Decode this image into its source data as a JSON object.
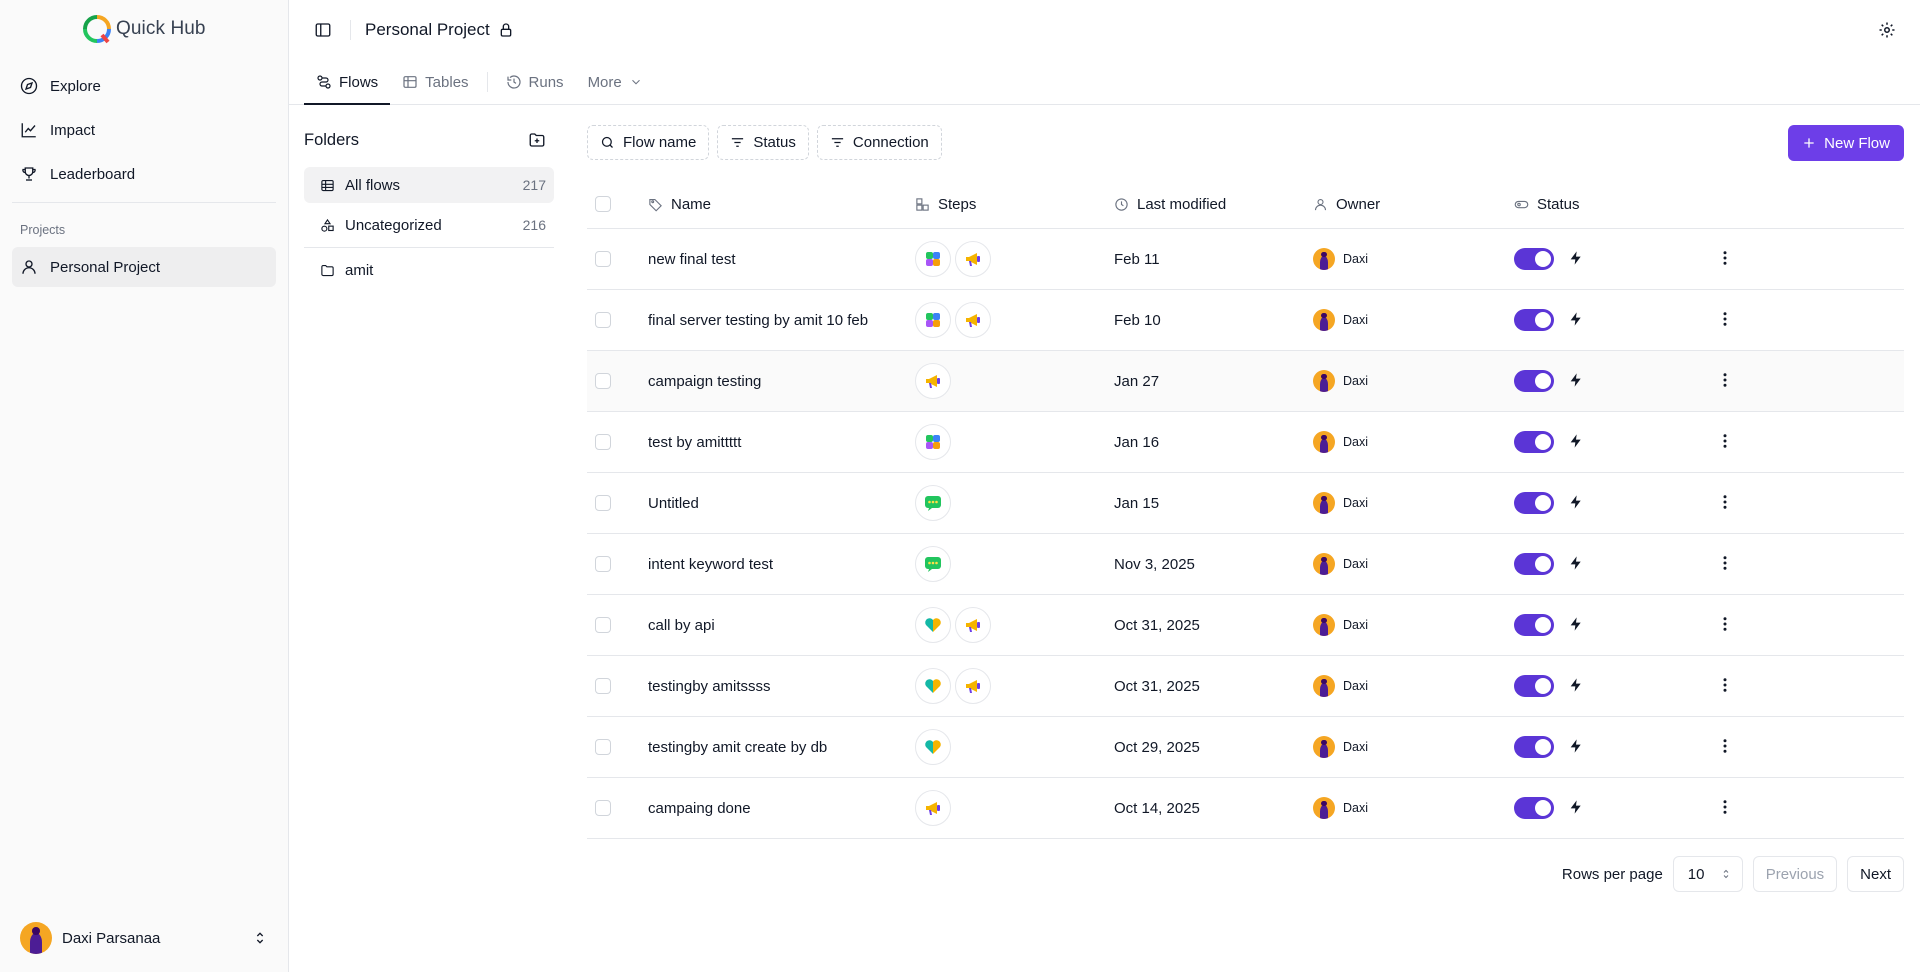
{
  "brand": {
    "name": "Quick Hub"
  },
  "sidebar": {
    "nav": [
      {
        "label": "Explore",
        "icon": "compass-icon"
      },
      {
        "label": "Impact",
        "icon": "chart-line-icon"
      },
      {
        "label": "Leaderboard",
        "icon": "trophy-icon"
      }
    ],
    "projects_label": "Projects",
    "project": {
      "label": "Personal Project",
      "icon": "user-icon"
    },
    "user": {
      "name": "Daxi Parsanaa"
    }
  },
  "header": {
    "title": "Personal Project"
  },
  "tabs": [
    {
      "label": "Flows",
      "active": true
    },
    {
      "label": "Tables",
      "active": false
    },
    {
      "label": "Runs",
      "active": false
    },
    {
      "label": "More",
      "active": false
    }
  ],
  "folders": {
    "title": "Folders",
    "items": [
      {
        "label": "All flows",
        "count": "217"
      },
      {
        "label": "Uncategorized",
        "count": "216"
      },
      {
        "label": "amit",
        "count": ""
      }
    ]
  },
  "filters": {
    "flow_name": "Flow name",
    "status": "Status",
    "connection": "Connection"
  },
  "new_flow_label": "New Flow",
  "table": {
    "columns": {
      "name": "Name",
      "steps": "Steps",
      "modified": "Last modified",
      "owner": "Owner",
      "status": "Status"
    },
    "rows": [
      {
        "name": "new final test",
        "steps": [
          "multicolor-app-icon",
          "megaphone-icon"
        ],
        "modified": "Feb 11",
        "owner": "Daxi",
        "enabled": true
      },
      {
        "name": "final server testing by amit 10 feb",
        "steps": [
          "multicolor-app-icon",
          "megaphone-icon"
        ],
        "modified": "Feb 10",
        "owner": "Daxi",
        "enabled": true
      },
      {
        "name": "campaign testing",
        "steps": [
          "megaphone-icon"
        ],
        "modified": "Jan 27",
        "owner": "Daxi",
        "enabled": true
      },
      {
        "name": "test by amittttt",
        "steps": [
          "multicolor-app-icon"
        ],
        "modified": "Jan 16",
        "owner": "Daxi",
        "enabled": true
      },
      {
        "name": "Untitled",
        "steps": [
          "chat-bubble-icon"
        ],
        "modified": "Jan 15",
        "owner": "Daxi",
        "enabled": true
      },
      {
        "name": "intent keyword test",
        "steps": [
          "chat-bubble-icon"
        ],
        "modified": "Nov 3, 2025",
        "owner": "Daxi",
        "enabled": true
      },
      {
        "name": "call by api",
        "steps": [
          "heart-icon",
          "megaphone-icon"
        ],
        "modified": "Oct 31, 2025",
        "owner": "Daxi",
        "enabled": true
      },
      {
        "name": "testingby amitssss",
        "steps": [
          "heart-icon",
          "megaphone-icon"
        ],
        "modified": "Oct 31, 2025",
        "owner": "Daxi",
        "enabled": true
      },
      {
        "name": "testingby amit create by db",
        "steps": [
          "heart-icon"
        ],
        "modified": "Oct 29, 2025",
        "owner": "Daxi",
        "enabled": true
      },
      {
        "name": "campaing done",
        "steps": [
          "megaphone-icon"
        ],
        "modified": "Oct 14, 2025",
        "owner": "Daxi",
        "enabled": true
      }
    ]
  },
  "pagination": {
    "rows_label": "Rows per page",
    "rows_value": "10",
    "previous": "Previous",
    "next": "Next"
  },
  "colors": {
    "accent": "#6d3ee8",
    "toggle": "#5b35d6",
    "avatar": "#f5a623"
  }
}
